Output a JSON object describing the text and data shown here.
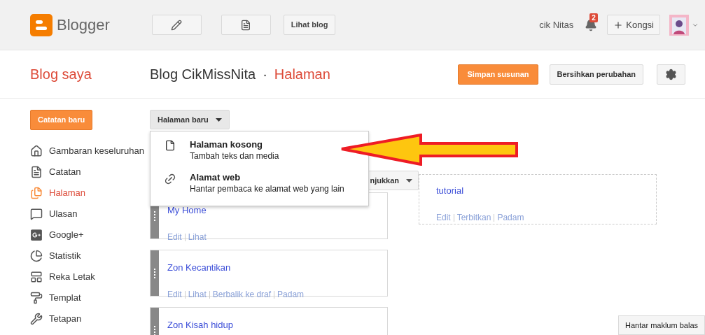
{
  "header": {
    "logo_text": "Blogger",
    "view_blog_button": "Lihat blog",
    "user_name": "cik Nitas",
    "notification_count": "2",
    "share_button": "Kongsi"
  },
  "subheader": {
    "my_blogs_link": "Blog saya",
    "blog_title": "Blog CikMissNita",
    "separator": "·",
    "section_title": "Halaman",
    "save_button": "Simpan susunan",
    "clear_button": "Bersihkan perubahan"
  },
  "sidebar": {
    "new_post_button": "Catatan baru",
    "items": [
      {
        "label": "Gambaran keseluruhan",
        "selected": false
      },
      {
        "label": "Catatan",
        "selected": false
      },
      {
        "label": "Halaman",
        "selected": true
      },
      {
        "label": "Ulasan",
        "selected": false
      },
      {
        "label": "Google+",
        "selected": false
      },
      {
        "label": "Statistik",
        "selected": false
      },
      {
        "label": "Reka Letak",
        "selected": false
      },
      {
        "label": "Templat",
        "selected": false
      },
      {
        "label": "Tetapan",
        "selected": false
      }
    ]
  },
  "new_page_menu": {
    "button": "Halaman baru",
    "expanded": true,
    "items": [
      {
        "kind": "blank",
        "title": "Halaman kosong",
        "description": "Tambah teks dan media"
      },
      {
        "kind": "link",
        "title": "Alamat web",
        "description": "Hantar pembaca ke alamat web yang lain"
      }
    ]
  },
  "show_button_partial": "njukkan",
  "pages": [
    {
      "title": "My Home",
      "actions": [
        "Edit",
        "Lihat"
      ]
    },
    {
      "title": "Zon Kecantikan",
      "actions": [
        "Edit",
        "Lihat",
        "Berbalik ke draf",
        "Padam"
      ]
    },
    {
      "title": "Zon Kisah hidup"
    }
  ],
  "drafts": [
    {
      "title": "tutorial",
      "actions": [
        "Edit",
        "Terbitkan",
        "Padam"
      ]
    }
  ],
  "feedback_button": "Hantar maklum balas"
}
